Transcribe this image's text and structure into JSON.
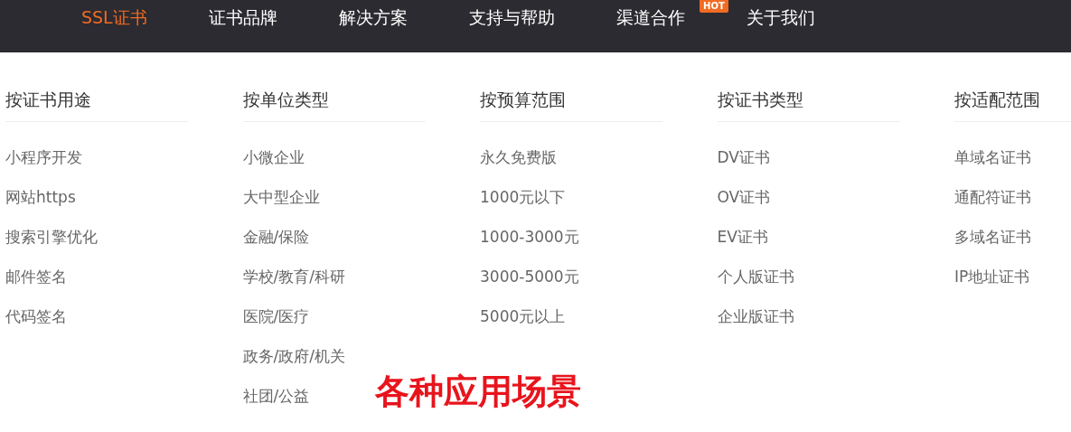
{
  "nav": {
    "items": [
      {
        "label": "SSL证书",
        "selected": true
      },
      {
        "label": "证书品牌",
        "selected": false
      },
      {
        "label": "解决方案",
        "selected": false
      },
      {
        "label": "支持与帮助",
        "selected": false
      },
      {
        "label": "渠道合作",
        "selected": false,
        "badge": "HOT"
      },
      {
        "label": "关于我们",
        "selected": false
      }
    ]
  },
  "menu": {
    "columns": [
      {
        "heading": "按证书用途",
        "items": [
          "小程序开发",
          "网站https",
          "搜索引擎优化",
          "邮件签名",
          "代码签名"
        ]
      },
      {
        "heading": "按单位类型",
        "items": [
          "小微企业",
          "大中型企业",
          "金融/保险",
          "学校/教育/科研",
          "医院/医疗",
          "政务/政府/机关",
          "社团/公益"
        ]
      },
      {
        "heading": "按预算范围",
        "items": [
          "永久免费版",
          "1000元以下",
          "1000-3000元",
          "3000-5000元",
          "5000元以上"
        ]
      },
      {
        "heading": "按证书类型",
        "items": [
          "DV证书",
          "OV证书",
          "EV证书",
          "个人版证书",
          "企业版证书"
        ]
      },
      {
        "heading": "按适配范围",
        "items": [
          "单域名证书",
          "通配符证书",
          "多域名证书",
          "IP地址证书"
        ]
      }
    ]
  },
  "annotation": "各种应用场景"
}
